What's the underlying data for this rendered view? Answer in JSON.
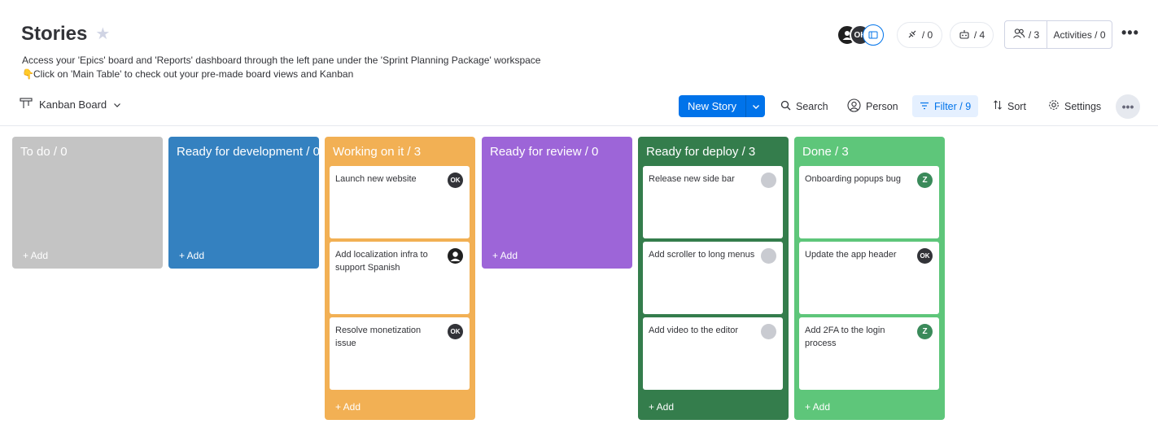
{
  "header": {
    "title": "Stories",
    "line1": "Access your 'Epics' board and 'Reports' dashboard through the left pane under the 'Sprint Planning Package' workspace",
    "line2": "Click on 'Main Table' to check out your pre-made board views and Kanban",
    "avatar2": "OK",
    "integrations_count": "/ 0",
    "automations_count": "/ 4",
    "members_count": "/ 3",
    "activities": "Activities / 0"
  },
  "toolbar": {
    "view_name": "Kanban Board",
    "new_item": "New Story",
    "search": "Search",
    "person": "Person",
    "filter": "Filter / 9",
    "sort": "Sort",
    "settings": "Settings"
  },
  "colors": {
    "todo": "#c4c4c4",
    "ready_dev": "#3481c0",
    "working": "#f2b054",
    "review": "#9d65d8",
    "deploy": "#347d4c",
    "done": "#5ec67a",
    "accent": "#0073ea"
  },
  "columns": [
    {
      "title": "To do / 0",
      "add": "+ Add",
      "cards": []
    },
    {
      "title": "Ready for development / 0",
      "add": "+ Add",
      "cards": []
    },
    {
      "title": "Working on it / 3",
      "add": "+ Add",
      "cards": [
        {
          "text": "Launch new website",
          "owner": "OK"
        },
        {
          "text": "Add localization infra to support Spanish",
          "owner": ""
        },
        {
          "text": "Resolve monetization issue",
          "owner": "OK"
        }
      ]
    },
    {
      "title": "Ready for review / 0",
      "add": "+ Add",
      "cards": []
    },
    {
      "title": "Ready for deploy / 3",
      "add": "+ Add",
      "cards": [
        {
          "text": "Release new side bar",
          "owner": ""
        },
        {
          "text": "Add scroller to long menus",
          "owner": ""
        },
        {
          "text": "Add video to the editor",
          "owner": ""
        }
      ]
    },
    {
      "title": "Done / 3",
      "add": "+ Add",
      "cards": [
        {
          "text": "Onboarding popups bug",
          "owner": "Z"
        },
        {
          "text": "Update the app header",
          "owner": "OK"
        },
        {
          "text": "Add 2FA to the login process",
          "owner": "Z"
        }
      ]
    }
  ]
}
